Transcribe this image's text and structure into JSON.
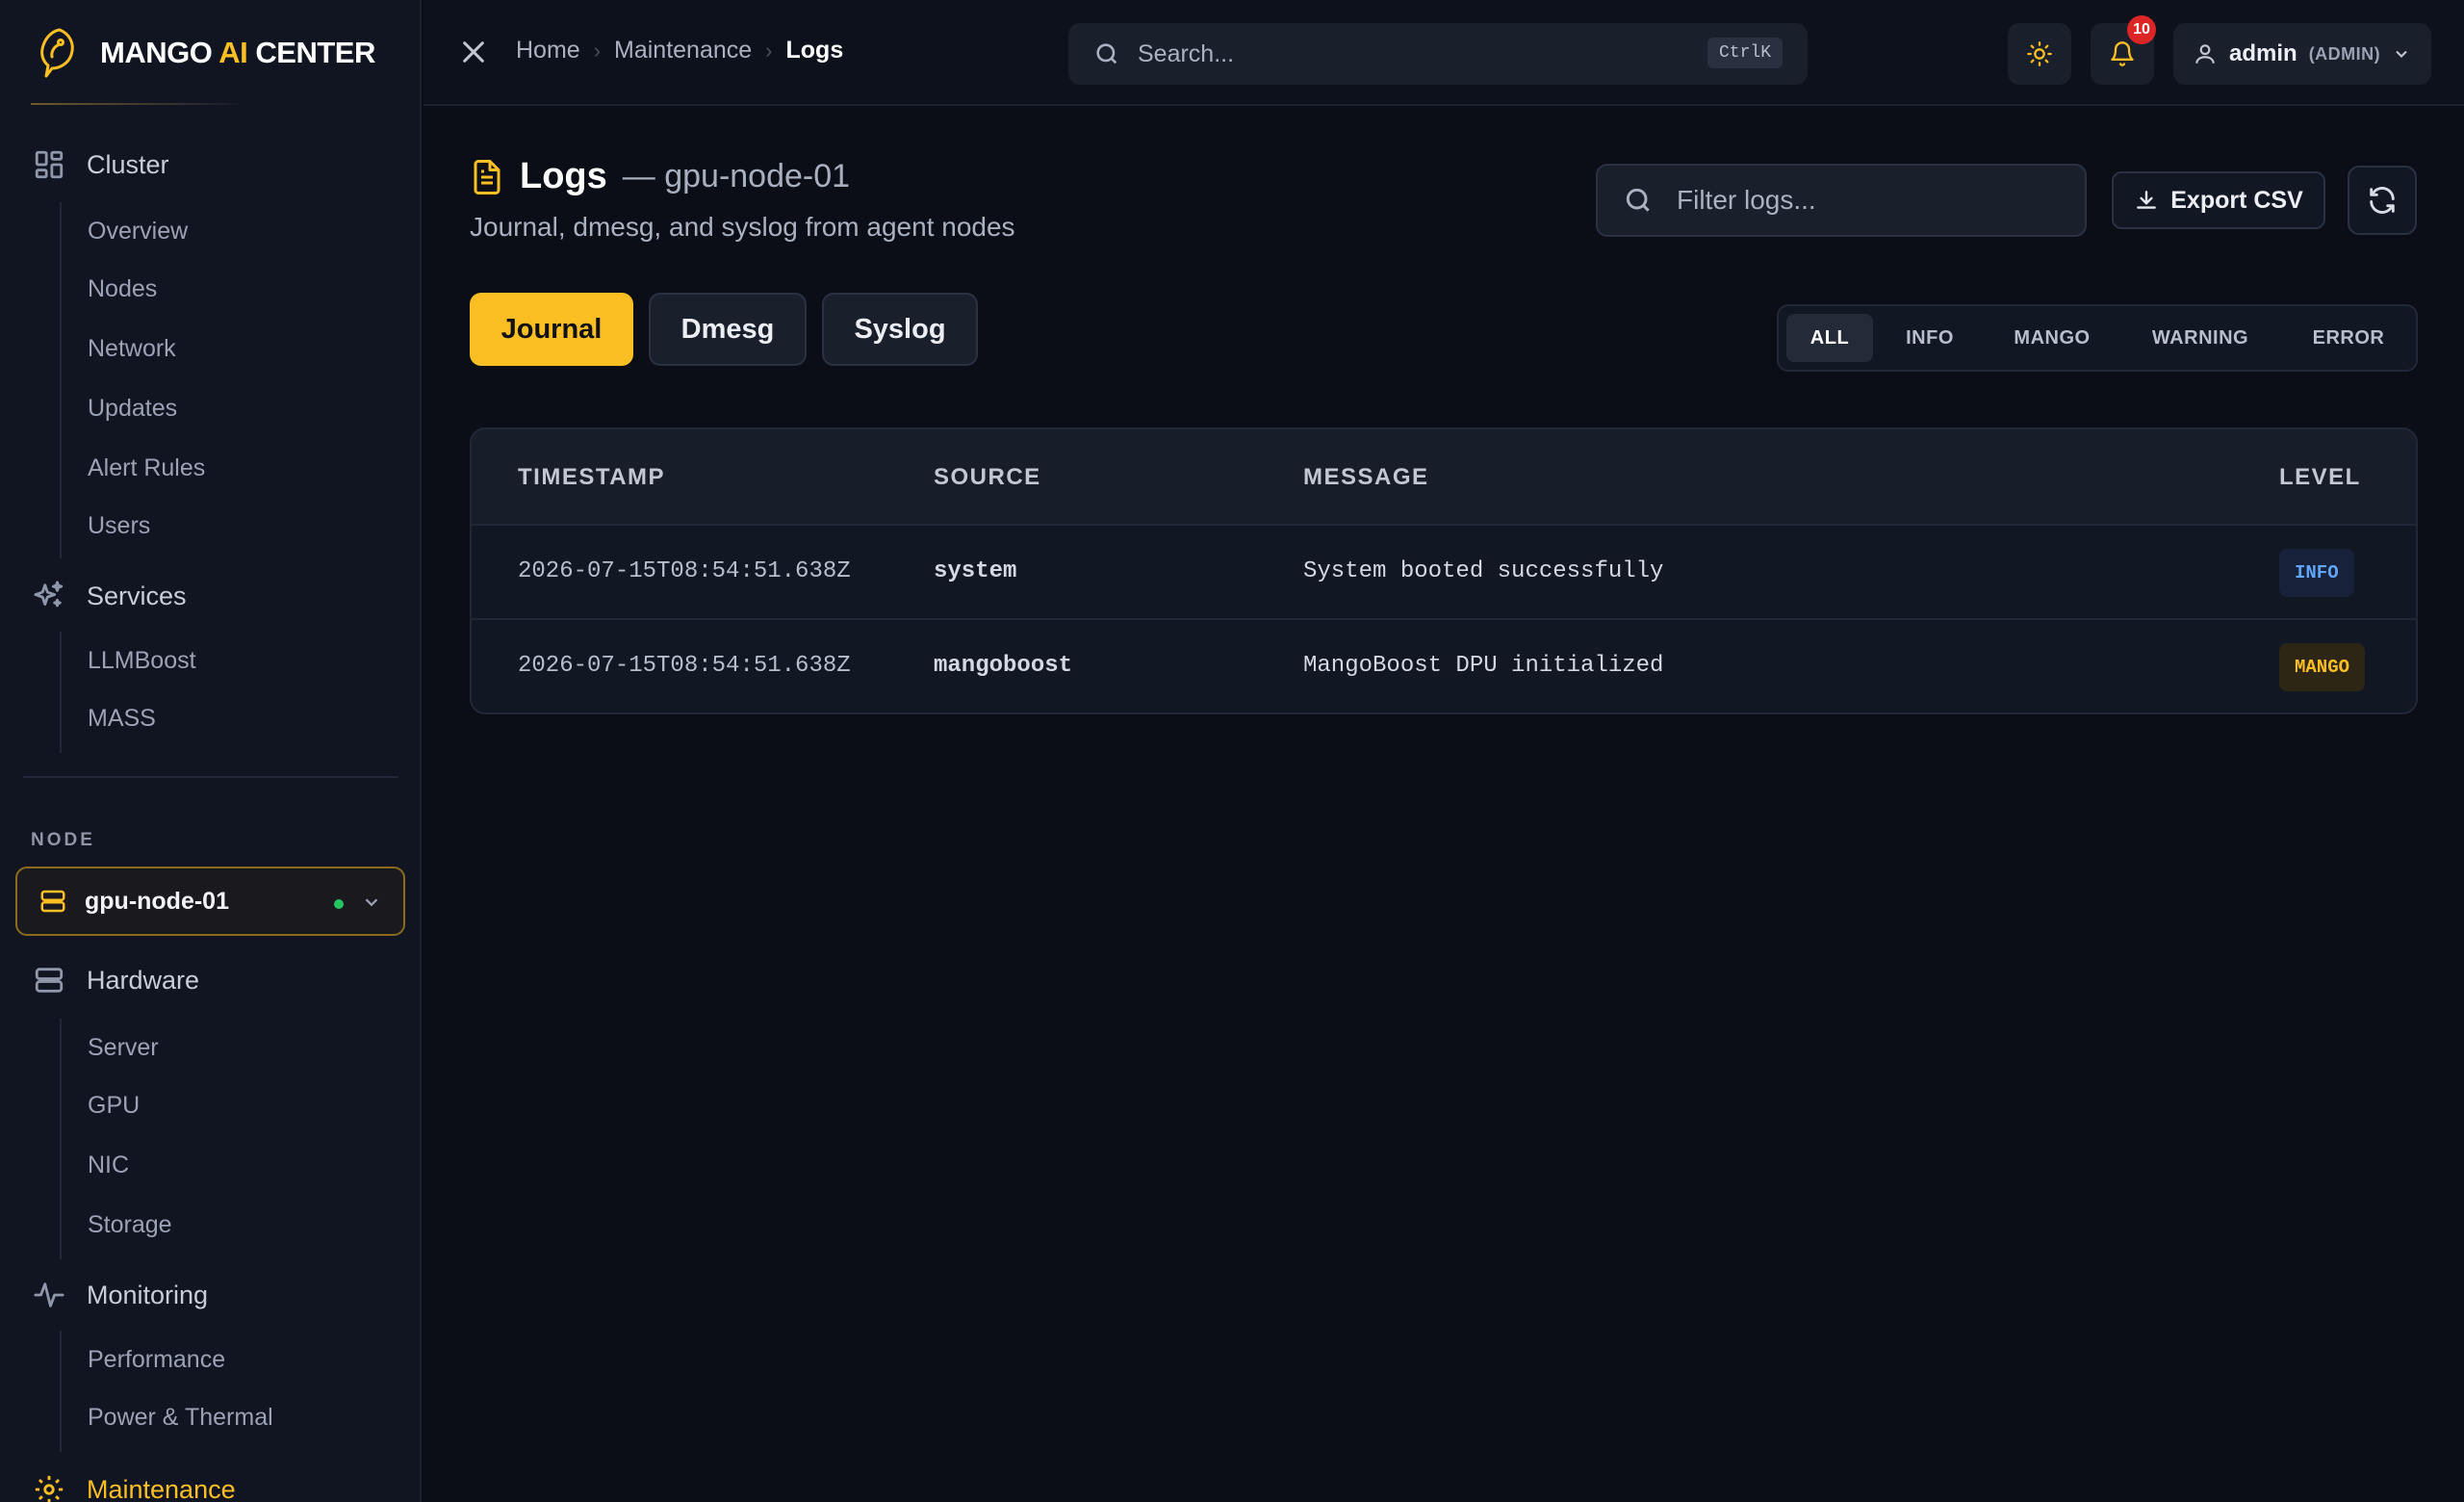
{
  "brand": {
    "name_part1": "MANGO ",
    "name_ai": "AI",
    "name_part2": " CENTER"
  },
  "sidebar": {
    "groups": [
      {
        "label": "Cluster",
        "icon": "dashboard-grid-icon",
        "items": [
          "Overview",
          "Nodes",
          "Network",
          "Updates",
          "Alert Rules",
          "Users"
        ]
      },
      {
        "label": "Services",
        "icon": "sparkles-icon",
        "items": [
          "LLMBoost",
          "MASS"
        ]
      },
      {
        "label": "Hardware",
        "icon": "server-icon",
        "items": [
          "Server",
          "GPU",
          "NIC",
          "Storage"
        ]
      },
      {
        "label": "Monitoring",
        "icon": "activity-icon",
        "items": [
          "Performance",
          "Power & Thermal"
        ]
      },
      {
        "label": "Maintenance",
        "icon": "gear-icon",
        "active": true
      }
    ],
    "node_label": "NODE",
    "node_select": {
      "value": "gpu-node-01",
      "status_color": "#22c55e"
    }
  },
  "topbar": {
    "breadcrumb": [
      "Home",
      "Maintenance",
      "Logs"
    ],
    "search_placeholder": "Search...",
    "search_shortcut": "CtrlK",
    "notification_count": "10",
    "user": {
      "name": "admin",
      "role": "(ADMIN)"
    }
  },
  "main": {
    "title": "Logs",
    "title_suffix": "— gpu-node-01",
    "description": "Journal, dmesg, and syslog from agent nodes",
    "filter_placeholder": "Filter logs...",
    "export_label": "Export CSV",
    "tabs": [
      {
        "label": "Journal",
        "active": true
      },
      {
        "label": "Dmesg",
        "active": false
      },
      {
        "label": "Syslog",
        "active": false
      }
    ],
    "levels": [
      {
        "label": "ALL",
        "active": true
      },
      {
        "label": "INFO"
      },
      {
        "label": "MANGO"
      },
      {
        "label": "WARNING"
      },
      {
        "label": "ERROR"
      }
    ],
    "table": {
      "headers": [
        "TIMESTAMP",
        "SOURCE",
        "MESSAGE",
        "LEVEL"
      ],
      "rows": [
        {
          "timestamp": "2026-07-15T08:54:51.638Z",
          "source": "system",
          "message": "System booted successfully",
          "level": "INFO"
        },
        {
          "timestamp": "2026-07-15T08:54:51.638Z",
          "source": "mangoboost",
          "message": "MangoBoost DPU initialized",
          "level": "MANGO"
        }
      ]
    }
  },
  "colors": {
    "accent": "#fbbf24",
    "info": "#60a5fa",
    "danger": "#dc2626",
    "bg": "#0b0e17"
  }
}
